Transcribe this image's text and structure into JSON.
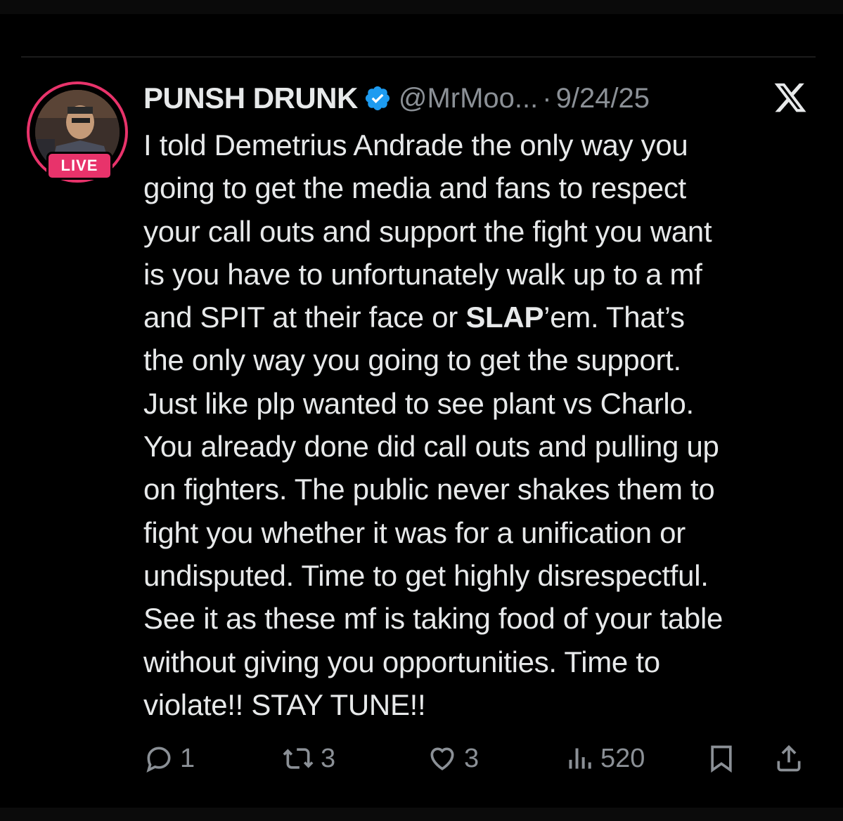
{
  "post": {
    "author_name": "PUNSH DRUNK",
    "handle": "@MrMoo...",
    "separator": "·",
    "date": "9/24/25",
    "live_label": "LIVE",
    "body_line_1": "I told Demetrius Andrade the only way you",
    "body_line_2": "going to get the media and fans to respect",
    "body_line_3": "your call outs and support the fight you want",
    "body_line_4": "is you have to unfortunately walk up to a mf",
    "body_line_5_a": "and SPIT at their face or ",
    "body_line_5_bold": "SLAP",
    "body_line_5_b": "’em. That’s",
    "body_line_6": "the only way you going to get the support.",
    "body_line_7": "Just like plp wanted to see plant vs Charlo.",
    "body_line_8": "You already done did call outs and pulling up",
    "body_line_9": "on fighters. The public never shakes them to",
    "body_line_10": "fight you whether it was for a unification or",
    "body_line_11": "undisputed. Time to get highly disrespectful.",
    "body_line_12": "See it as these mf is taking food of your table",
    "body_line_13": "without giving you opportunities. Time to",
    "body_line_14": "violate!! STAY TUNE!!"
  },
  "actions": {
    "replies": "1",
    "reposts": "3",
    "likes": "3",
    "views": "520"
  },
  "icons": {
    "verified": "verified-badge-icon",
    "brand": "x-logo-icon",
    "reply": "reply-icon",
    "repost": "repost-icon",
    "like": "heart-icon",
    "views": "views-icon",
    "bookmark": "bookmark-icon",
    "share": "share-icon"
  },
  "colors": {
    "background": "#000000",
    "text": "#e7e9ea",
    "muted": "#8b9096",
    "live": "#e8336b",
    "verified": "#1d9bf0"
  }
}
